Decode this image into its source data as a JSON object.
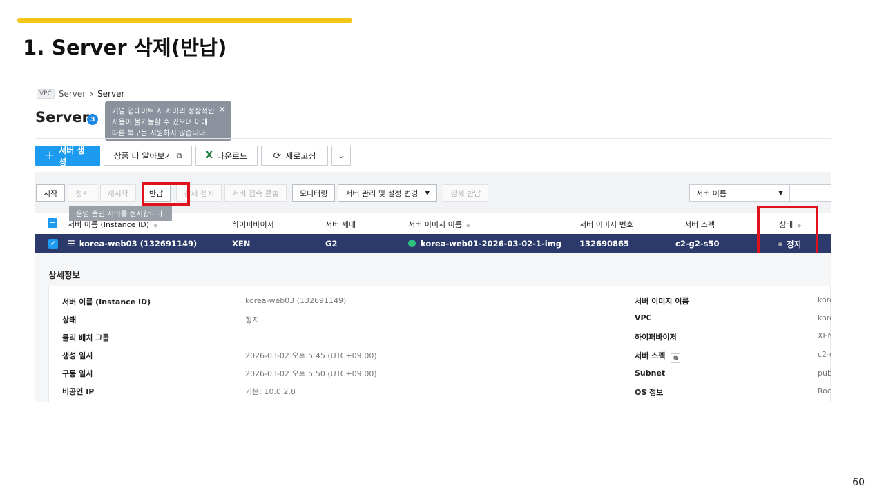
{
  "slide": {
    "title": "1. Server 삭제(반납)",
    "page_number": "60",
    "accent_color": "#f5c518",
    "highlight_color": "#e0101c"
  },
  "breadcrumb": {
    "tag": "VPC",
    "parent": "Server",
    "current": "Server"
  },
  "page": {
    "title": "Server",
    "count": "3"
  },
  "notice_tooltip": {
    "text": "커널 업데이트 시 서버의 정상적인\n사용이 불가능할 수 있으며 이에\n따른 복구는 지원하지 않습니다.",
    "close_icon": "close-icon"
  },
  "toolbar": {
    "create_label": "서버 생성",
    "learn_more_label": "상품 더 알아보기",
    "download_label": "다운로드",
    "refresh_label": "새로고침"
  },
  "actions": {
    "start": "시작",
    "stop": "정지",
    "restart": "재시작",
    "return": "반납",
    "force_stop": "강제 정지",
    "console": "서버 접속 콘솔",
    "monitoring": "모니터링",
    "manage": "서버 관리 및 설정 변경",
    "force_return": "강제 반납"
  },
  "search_filter": {
    "selected": "서버 이름"
  },
  "hover_tip": "운영 중인 서버를 정지합니다.",
  "table": {
    "headers": {
      "name": "서버 이름 (Instance ID)",
      "hypervisor": "하이퍼바이저",
      "generation": "서버 세대",
      "image_name": "서버 이미지 이름",
      "image_no": "서버 이미지 번호",
      "spec": "서버 스펙",
      "status": "상태"
    },
    "selected_row": {
      "name": "korea-web03 (132691149)",
      "hypervisor": "XEN",
      "generation": "G2",
      "image_name": "korea-web01-2026-03-02-1-img",
      "image_no": "132690865",
      "spec": "c2-g2-s50",
      "status": "정지",
      "status_color": "#9aa0a8"
    }
  },
  "details": {
    "title": "상세정보",
    "left": [
      {
        "label": "서버 이름 (Instance ID)",
        "value": "korea-web03 (132691149)"
      },
      {
        "label": "상태",
        "value": "정지"
      },
      {
        "label": "물리 배치 그룹",
        "value": ""
      },
      {
        "label": "생성 일시",
        "value": "2026-03-02 오후 5:45 (UTC+09:00)"
      },
      {
        "label": "구동 일시",
        "value": "2026-03-02 오후 5:50 (UTC+09:00)"
      },
      {
        "label": "비공인 IP",
        "value": "기본: 10.0.2.8"
      }
    ],
    "right": [
      {
        "label": "서버 이미지 이름",
        "value": "kore"
      },
      {
        "label": "VPC",
        "value": "kore"
      },
      {
        "label": "하이퍼바이저",
        "value": "XEN"
      },
      {
        "label": "서버 스펙",
        "value": "c2-g"
      },
      {
        "label": "Subnet",
        "value": "pub"
      },
      {
        "label": "OS 정보",
        "value": "Roc"
      }
    ]
  }
}
